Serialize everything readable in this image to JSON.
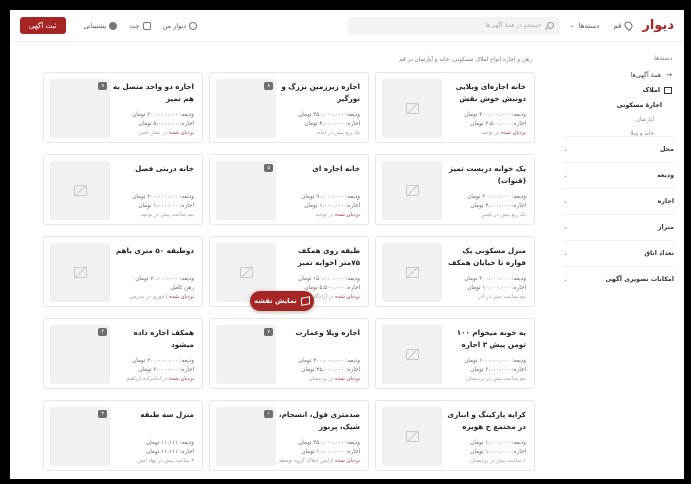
{
  "header": {
    "logo": "دیوار",
    "city": "قم",
    "categories": "دسته‌ها",
    "search_placeholder": "جستجو در همهٔ آگهی‌ها",
    "my_divar": "دیوار من",
    "chat": "چت",
    "support": "پشتیبانی",
    "post_button": "ثبت آگهی"
  },
  "sidebar": {
    "title": "دسته‌ها",
    "all_ads": "همهٔ آگهی‌ها",
    "real_estate": "املاک",
    "residential_rent": "اجارهٔ مسکونی",
    "apartment": "آپارتمان",
    "house_villa": "خانه و ویلا",
    "filters": [
      "محل",
      "ودیعه",
      "اجاره",
      "متراژ",
      "تعداد اتاق",
      "امکانات تصویری آگهی"
    ]
  },
  "breadcrumb": "رهن و اجاره انواع املاک مسکونی، خانه و آپارتمان در قم",
  "map_button": "نمایش نقشه",
  "colors": {
    "brand": "#a62626"
  },
  "cards": [
    {
      "title": "خانه اجاره‌ای ویلایی دونبش خوش نقش",
      "deposit": "ودیعه: ۳۰۰،۰۰۰،۰۰۰ تومان",
      "rent": "اجاره: ۳،۵۰۰،۰۰۰ تومان",
      "meta_red": "نردبان شده",
      "meta": "در توحید",
      "image": "",
      "count": ""
    },
    {
      "title": "اجاره زیرزمین بزرگ و نورگیر",
      "deposit": "ودیعه: ۳۵۰،۰۰۰،۰۰۰ تومان",
      "rent": "اجاره: ۴،۰۰۰،۰۰۰ تومان",
      "meta_red": "",
      "meta": "یک ربع پیش در امام",
      "image": "room1",
      "count": "۸"
    },
    {
      "title": "اجاره دو واحد متصل به هم تمیز",
      "deposit": "ودیعه: ۲۰۰،۰۰۰،۰۰۰ تومان",
      "rent": "اجاره: ۵،۰۰۰،۰۰۰ تومان",
      "meta_red": "نردبان شده",
      "meta": "در عمار یاسر",
      "image": "room2",
      "count": "۹"
    },
    {
      "title": "یک خوابه دربست تمیز (قنوات)",
      "deposit": "ودیعه: ۲۰،۰۰۰،۰۰۰ تومان",
      "rent": "اجاره: ۴،۰۰۰،۰۰۰ تومان",
      "meta_red": "",
      "meta": "یک ربع پیش در پلیس",
      "image": "",
      "count": ""
    },
    {
      "title": "خانه اجاره ای",
      "deposit": "ودیعه: ۹۰،۰۰۰،۰۰۰ تومان",
      "rent": "اجاره: ۱،۰۰۰،۰۰۰ تومان",
      "meta_red": "نردبان شده",
      "meta": "در توحید",
      "image": "door",
      "count": "۵"
    },
    {
      "title": "خانه دربنی فصل",
      "deposit": "ودیعه: ۲۰۰،۰۰۰،۰۰۰ تومان",
      "rent": "اجاره: ۱،۰۰۰،۰۰۰ تومان",
      "meta_red": "",
      "meta": "نیم ساعت پیش در توحید",
      "image": "",
      "count": ""
    },
    {
      "title": "منزل مسکونی یک فواره تا خیابان همکف و دربست",
      "deposit": "ودیعه: ۲۰۰،۰۰۰،۰۰۰ تومان",
      "rent": "اجاره: ۱۰،۰۰۰،۰۰۰ تومان",
      "meta_red": "",
      "meta": "نیم ساعت پیش در آذر",
      "image": "",
      "count": ""
    },
    {
      "title": "طبقه روی همکف ۷۵متر اخوابه تمیز",
      "deposit": "ودیعه: ۱۵۰،۰۰۰،۰۰۰ تومان",
      "rent": "اجاره: ۵،۵۰۰،۰۰۰ تومان",
      "meta_red": "نردبان شده",
      "meta": "در آزادگان",
      "image": "",
      "count": ""
    },
    {
      "title": "دوطبقه ۵۰ متری باهم",
      "deposit": "ودیعه: ۷۰،۰۰۰،۰۰۰ تومان",
      "rent": "رهن کامل",
      "meta_red": "نردبان شده",
      "meta": "| فوری در مدرس",
      "image": "",
      "count": ""
    },
    {
      "title": "یه خونه میخوام ۱۰۰ تومن پیش ۳ اجاره",
      "deposit": "ودیعه: ۱۰۰،۰۰۰،۰۰۰ تومان",
      "rent": "اجاره: ۳،۰۰۰،۰۰۰ تومان",
      "meta_red": "",
      "meta": "نیم ساعت پیش در پردیسان",
      "image": "",
      "count": ""
    },
    {
      "title": "اجاره ویلا وعمارت",
      "deposit": "ودیعه: ۳۰۰،۰۰۰،۰۰۰ تومان",
      "rent": "اجاره: ۴۵،۰۰۰،۰۰۰ تومان",
      "meta_red": "نردبان شده",
      "meta": "در پردیسان",
      "image": "villa",
      "count": "۷"
    },
    {
      "title": "همکف اجاره داده میشود",
      "deposit": "ودیعه: ۲۰۰،۰۰۰،۰۰۰ تومان",
      "rent": "اجاره: ۳،۰۰۰،۰۰۰ تومان",
      "meta_red": "نردبان شده",
      "meta": "در امامزاده ابراهیم",
      "image": "kitchen",
      "count": "۴"
    },
    {
      "title": "کرایه پارکینگ و انباری در مجتمع خ هویزه",
      "deposit": "ودیعه: ۱،۰۰۰،۰۰۰ تومان",
      "rent": "اجاره: ۱،۰۰۰،۰۰۰ تومان",
      "meta_red": "",
      "meta": "۱ ساعت پیش در پردیسان",
      "image": "",
      "count": ""
    },
    {
      "title": "صدمتری فول، انسجام، شیک، پرنور",
      "deposit": "ودیعه: ۳۵۰،۰۰۰،۰۰۰ تومان",
      "rent": "اجاره: ۱۰،۰۰۰،۰۰۰ تومان",
      "meta_red": "نردبان شده",
      "meta": "آژانس املاک گروه توسعه",
      "image": "door2",
      "count": "۱"
    },
    {
      "title": "منزل سه طبقه",
      "deposit": "ودیعه: ۱۱،۱۱۱ تومان",
      "rent": "اجاره: ۱۱،۱۱۱ تومان",
      "meta_red": "",
      "meta": "۳ ساعت پیش در نهاد امین",
      "image": "hall",
      "count": "۳"
    }
  ]
}
